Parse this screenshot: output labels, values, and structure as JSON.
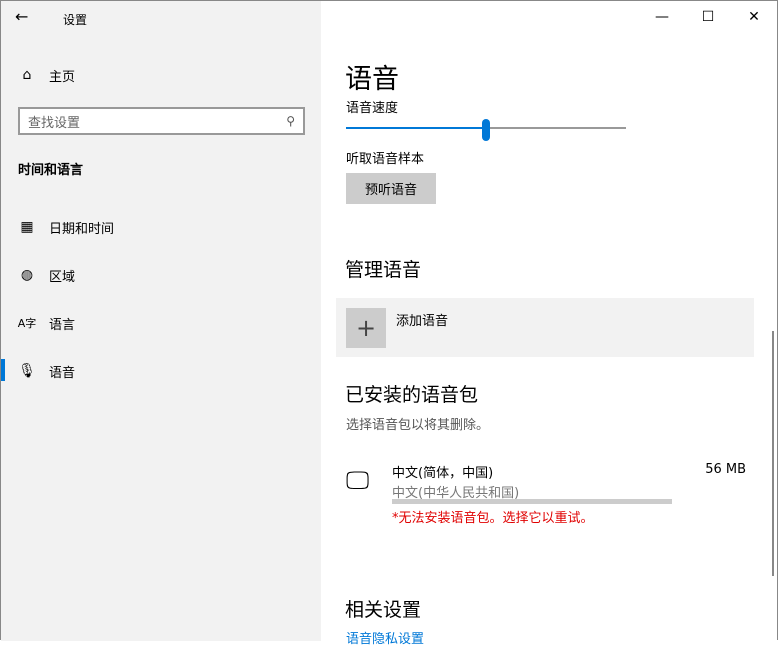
{
  "window": {
    "title": "设置"
  },
  "sidebar": {
    "home": "主页",
    "search_placeholder": "查找设置",
    "section": "时间和语言",
    "items": [
      {
        "label": "日期和时间"
      },
      {
        "label": "区域"
      },
      {
        "label": "语言"
      },
      {
        "label": "语音"
      }
    ]
  },
  "main": {
    "title": "语音",
    "speed_label": "语音速度",
    "speed_value": 0.5,
    "sample_label": "听取语音样本",
    "preview_button": "预听语音",
    "manage_heading": "管理语音",
    "add_voice": "添加语音",
    "installed_heading": "已安装的语音包",
    "installed_hint": "选择语音包以将其删除。",
    "pack": {
      "name": "中文(简体，中国)",
      "region": "中文(中华人民共和国)",
      "size": "56 MB",
      "error": "*无法安装语音包。选择它以重试。"
    },
    "related_heading": "相关设置",
    "privacy_link": "语音隐私设置"
  },
  "colors": {
    "accent": "#0078d7",
    "error": "#e00000"
  }
}
